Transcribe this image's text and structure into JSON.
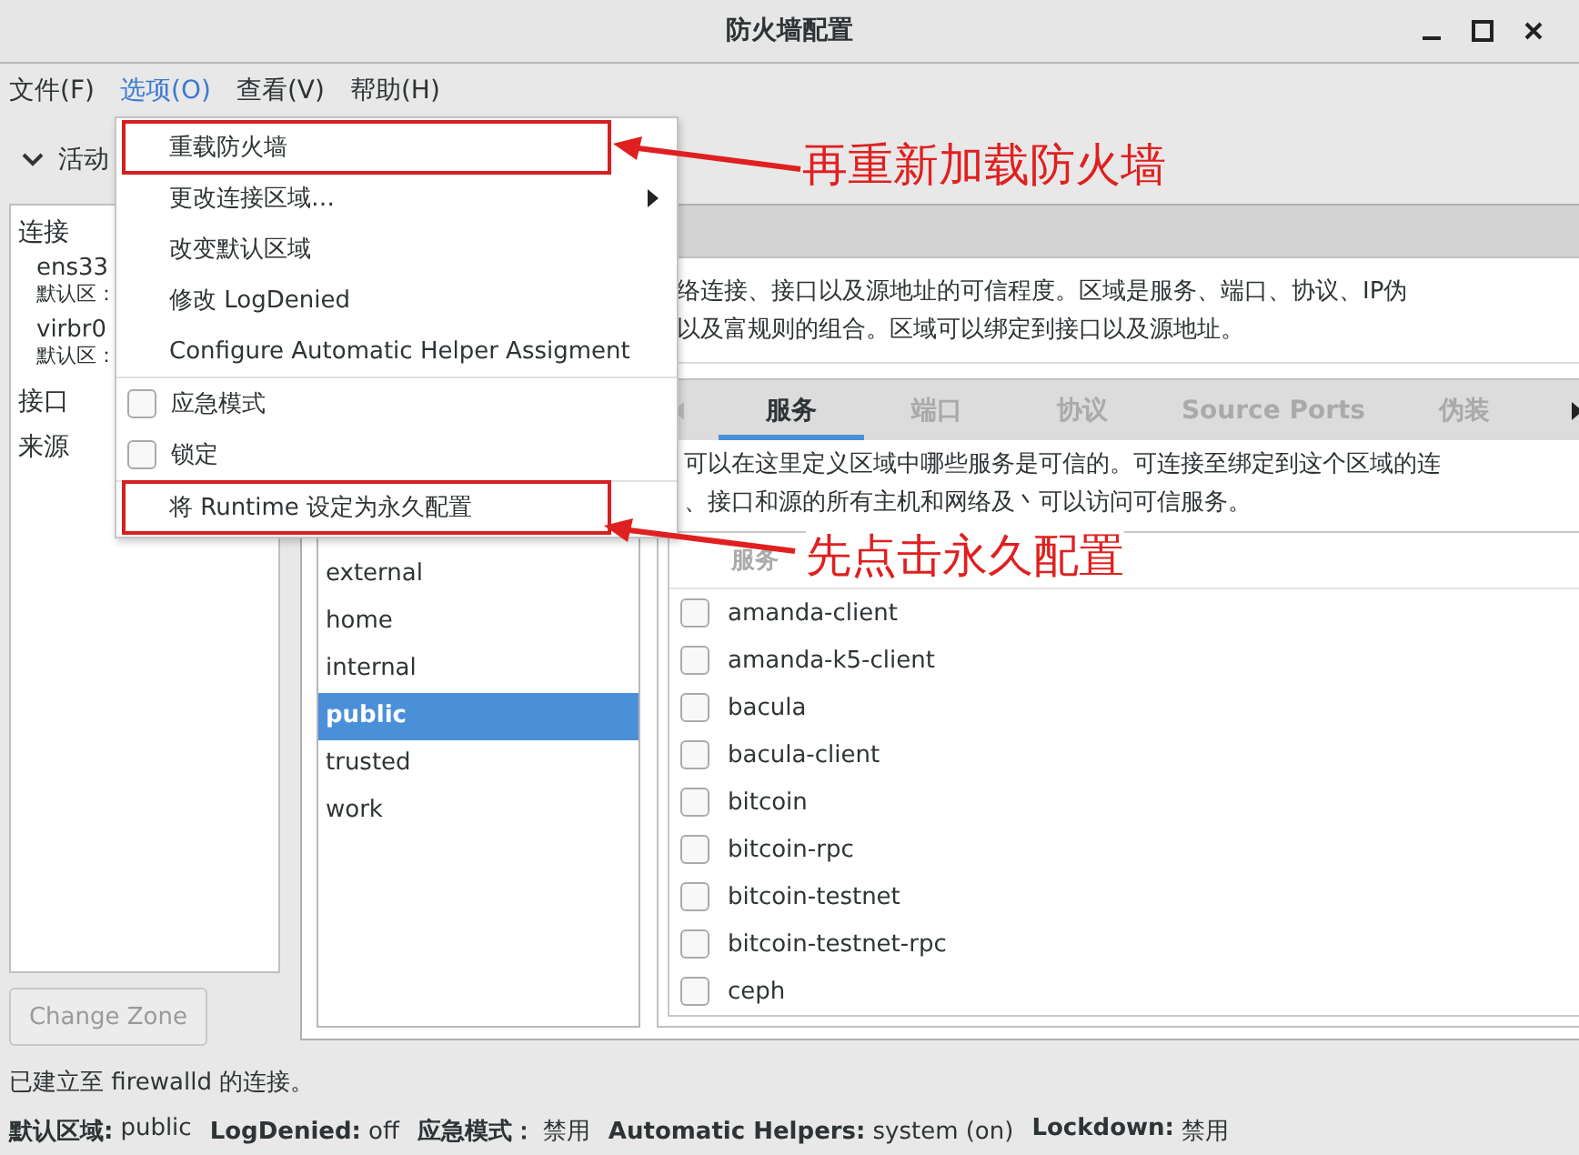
{
  "window": {
    "title": "防火墙配置"
  },
  "menu_bar": [
    {
      "label": "文件(F)",
      "selected": false
    },
    {
      "label": "选项(O)",
      "selected": true
    },
    {
      "label": "查看(V)",
      "selected": false
    },
    {
      "label": "帮助(H)",
      "selected": false
    }
  ],
  "options_menu": [
    {
      "kind": "item",
      "label": "重载防火墙",
      "annotated": true
    },
    {
      "kind": "submenu",
      "label": "更改连接区域…",
      "annotated": false
    },
    {
      "kind": "item",
      "label": "改变默认区域",
      "annotated": false
    },
    {
      "kind": "item",
      "label": "修改 LogDenied",
      "annotated": false
    },
    {
      "kind": "item",
      "label": "Configure Automatic Helper Assigment",
      "annotated": false
    },
    {
      "kind": "separator"
    },
    {
      "kind": "check",
      "label": "应急模式",
      "checked": false,
      "annotated": false
    },
    {
      "kind": "check",
      "label": "锁定",
      "checked": false,
      "annotated": false
    },
    {
      "kind": "separator"
    },
    {
      "kind": "item",
      "label": "将 Runtime 设定为永久配置",
      "annotated": true
    }
  ],
  "annotations": [
    {
      "text": "再重新加载防火墙"
    },
    {
      "text": "先点击永久配置"
    }
  ],
  "active_bindings": {
    "header": "活动",
    "expanded": true,
    "sections": [
      {
        "label": "连接",
        "children": [
          {
            "label": "ens33",
            "zone": "默认区："
          },
          {
            "label": "virbr0",
            "zone": "默认区："
          }
        ]
      },
      {
        "label": "接口"
      },
      {
        "label": "来源"
      }
    ]
  },
  "change_zone_button": {
    "label": "Change Zone",
    "disabled": true
  },
  "zone_description": [
    "络连接、接口以及源地址的可信程度。区域是服务、端口、协议、IP伪",
    "以及富规则的组合。区域可以绑定到接口以及源地址。"
  ],
  "zones": [
    {
      "label": "external",
      "selected": false
    },
    {
      "label": "home",
      "selected": false
    },
    {
      "label": "internal",
      "selected": false
    },
    {
      "label": "public",
      "selected": true
    },
    {
      "label": "trusted",
      "selected": false
    },
    {
      "label": "work",
      "selected": false
    }
  ],
  "tabs": [
    {
      "label": "服务",
      "selected": true
    },
    {
      "label": "端口",
      "selected": false
    },
    {
      "label": "协议",
      "selected": false
    },
    {
      "label": "Source Ports",
      "selected": false
    },
    {
      "label": "伪装",
      "selected": false
    }
  ],
  "services": {
    "description": [
      "可以在这里定义区域中哪些服务是可信的。可连接至绑定到这个区域的连",
      "、接口和源的所有主机和网络及丶可以访问可信服务。"
    ],
    "column": "服务",
    "rows": [
      {
        "label": "amanda-client",
        "checked": false
      },
      {
        "label": "amanda-k5-client",
        "checked": false
      },
      {
        "label": "bacula",
        "checked": false
      },
      {
        "label": "bacula-client",
        "checked": false
      },
      {
        "label": "bitcoin",
        "checked": false
      },
      {
        "label": "bitcoin-rpc",
        "checked": false
      },
      {
        "label": "bitcoin-testnet",
        "checked": false
      },
      {
        "label": "bitcoin-testnet-rpc",
        "checked": false
      },
      {
        "label": "ceph",
        "checked": false
      }
    ]
  },
  "status": "已建立至 firewalld 的连接。",
  "status_bar": [
    {
      "label": "默认区域:",
      "value": "public"
    },
    {
      "label": "LogDenied:",
      "value": "off"
    },
    {
      "label": "应急模式：",
      "value": "禁用"
    },
    {
      "label": "Automatic Helpers:",
      "value": "system (on)"
    },
    {
      "label": "Lockdown:",
      "value": "禁用"
    }
  ]
}
